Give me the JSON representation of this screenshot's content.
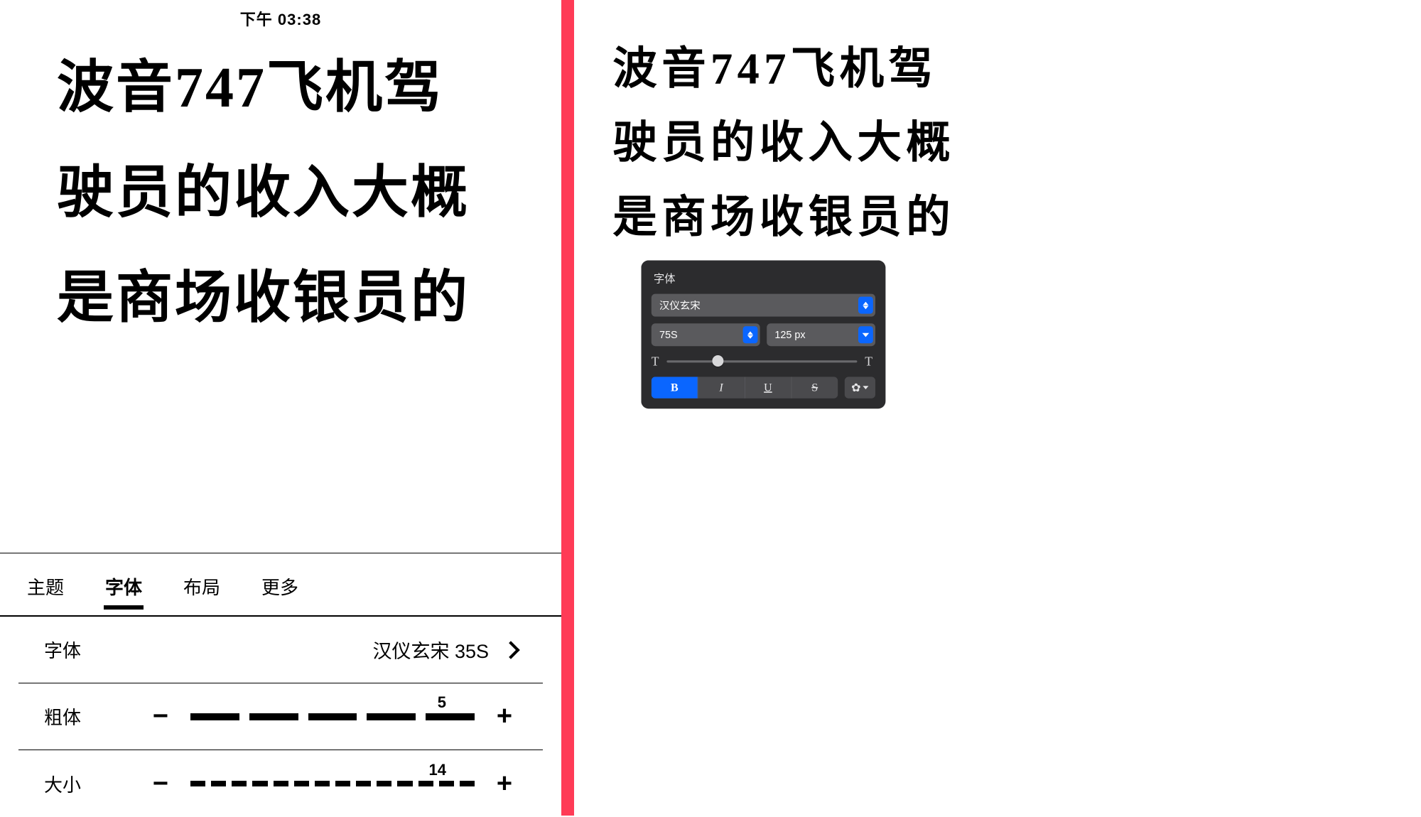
{
  "left": {
    "status_time": "下午 03:38",
    "text_lines": [
      "波音747飞机驾",
      "驶员的收入大概",
      "是商场收银员的"
    ],
    "tabs": {
      "theme": "主题",
      "font": "字体",
      "layout": "布局",
      "more": "更多"
    },
    "rows": {
      "font_label": "字体",
      "font_value": "汉仪玄宋 35S",
      "bold_label": "粗体",
      "bold_value": "5",
      "size_label": "大小",
      "size_value": "14"
    }
  },
  "right": {
    "text_lines": [
      "波音747飞机驾",
      "驶员的收入大概",
      "是商场收银员的"
    ],
    "panel": {
      "title": "字体",
      "font_name": "汉仪玄宋",
      "weight": "75S",
      "size": "125 px",
      "style_bold": "B",
      "style_italic": "I",
      "style_underline": "U",
      "style_strike": "S",
      "gear": "✿"
    }
  }
}
